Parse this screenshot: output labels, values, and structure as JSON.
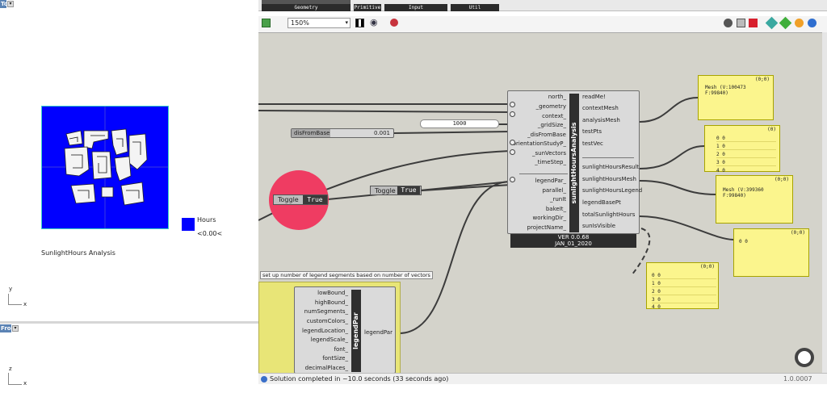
{
  "rhino": {
    "top_viewport_tag": "Top",
    "front_viewport_tag": "Front",
    "legend_label": "Hours",
    "legend_value": "<0.00<",
    "title_text": "SunlightHours Analysis",
    "axis_y": "y",
    "axis_x": "x",
    "axis_z": "z",
    "axis_x2": "x"
  },
  "gh": {
    "tabs": [
      "Geometry",
      "Primitive",
      "Input",
      "Util"
    ],
    "zoom": "150%",
    "status": "Solution completed in ~10.0 seconds (33 seconds ago)",
    "version": "1.0.0007",
    "colors": {
      "canvas": "#d4d3cb",
      "panel": "#fbf58d",
      "accent": "#e23a5f",
      "mesh": "#0000ff"
    }
  },
  "sunlight": {
    "title": "sunlightHoursAnalysis",
    "inputs": [
      "north_",
      "_geometry",
      "context_",
      "_gridSize_",
      "_disFromBase",
      "orientationStudyP_",
      "_sunVectors",
      "_timeStep_",
      "legendPar_",
      "parallel_",
      "_runIt",
      "bakeIt_",
      "workingDir_",
      "projectName_"
    ],
    "outputs": [
      "readMe!",
      "contextMesh",
      "analysisMesh",
      "testPts",
      "testVec",
      "sunlightHoursResult",
      "sunlightHoursMesh",
      "sunlightHoursLegend",
      "legendBasePt",
      "totalSunlightHours",
      "sunIsVisible"
    ],
    "version_line1": "VER 0.0.68",
    "version_line2": "JAN_01_2020"
  },
  "slider_gridsize": {
    "value": "1000"
  },
  "slider_dis": {
    "label": "disFromBase",
    "value": "0.001"
  },
  "toggle1": {
    "label": "Toggle",
    "value": "True"
  },
  "toggle2": {
    "label": "Toggle",
    "value": "True"
  },
  "legend_comp": {
    "group_label": "set up number of legend segments based on number of vectors",
    "title": "legendPar",
    "inputs": [
      "lowBound_",
      "highBound_",
      "numSegments_",
      "customColors_",
      "legendLocation_",
      "legendScale_",
      "font_",
      "fontSize_",
      "decimalPlaces_"
    ],
    "output": "legendPar"
  },
  "panels": {
    "p1": {
      "header": "(0;0)",
      "line1": "Mesh (V:100473",
      "line2": "F:99840)"
    },
    "p2": {
      "header": "(0)",
      "rows": [
        "0  0",
        "1  0",
        "2  0",
        "3  0",
        "4  0"
      ]
    },
    "p3": {
      "header": "(0;0)",
      "line1": "Mesh (V:399360",
      "line2": "F:99840)"
    },
    "p4": {
      "header": "(0;0)",
      "line1": "0  0"
    },
    "p5": {
      "header": "(0;0)",
      "rows": [
        "0  0",
        "1  0",
        "2  0",
        "3  0",
        "4  0"
      ]
    }
  }
}
